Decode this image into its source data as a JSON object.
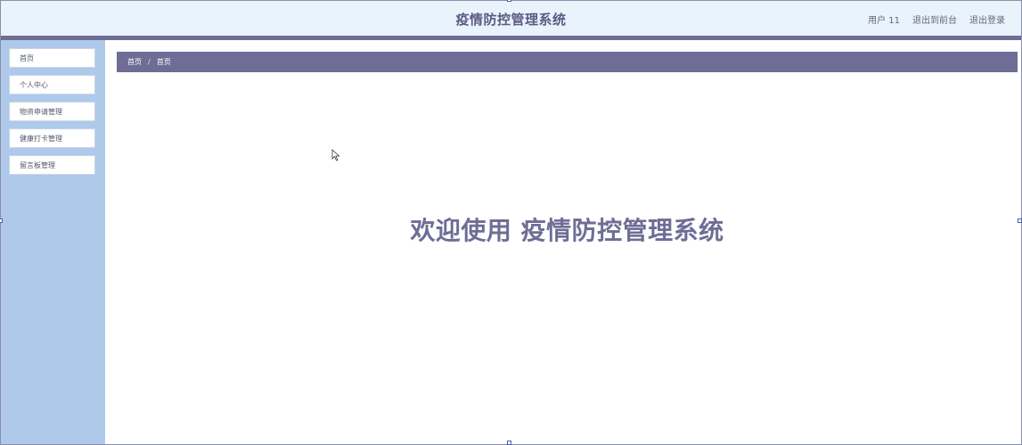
{
  "header": {
    "app_title": "疫情防控管理系统",
    "user_label": "用户 11",
    "exit_to_front": "退出到前台",
    "logout": "退出登录"
  },
  "sidebar": {
    "items": [
      {
        "label": "首页"
      },
      {
        "label": "个人中心"
      },
      {
        "label": "物资申请管理"
      },
      {
        "label": "健康打卡管理"
      },
      {
        "label": "留言板管理"
      }
    ]
  },
  "breadcrumb": {
    "home": "首页",
    "separator": "/",
    "current": "首页"
  },
  "main": {
    "welcome_text": "欢迎使用 疫情防控管理系统"
  },
  "colors": {
    "header_bg": "#e8f3fc",
    "accent": "#6f6d96",
    "sidebar_bg": "#aec9ea",
    "title_text": "#5c5a82"
  }
}
